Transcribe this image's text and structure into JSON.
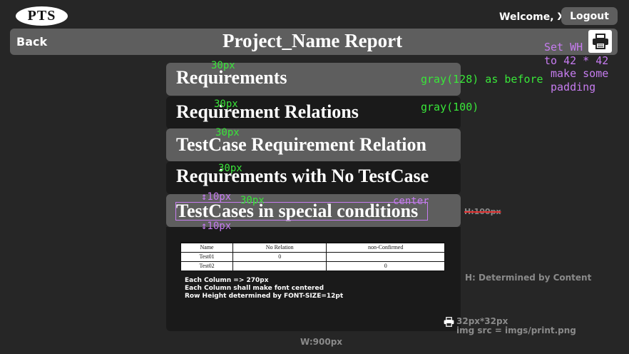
{
  "header": {
    "logo": "PTS",
    "welcome": "Welcome, XXX",
    "logout_label": "Logout"
  },
  "titlebar": {
    "back_label": "Back",
    "title": "Project_Name Report"
  },
  "menu": [
    {
      "label": "Requirements"
    },
    {
      "label": "Requirement Relations"
    },
    {
      "label": "TestCase Requirement Relation"
    },
    {
      "label": "Requirements with No TestCase"
    },
    {
      "label": "TestCases in special conditions"
    }
  ],
  "annotations": {
    "spacing": [
      "30px",
      "30px",
      "30px",
      "30px",
      "30px"
    ],
    "padding_top": "↕10px",
    "padding_bottom": "↕10px",
    "center": "center",
    "gray128": "gray(128) as before",
    "gray100": "gray(100)",
    "print_note_line1": "Set WH",
    "print_note_line2": "to 42 * 42",
    "print_note_line3": "make some",
    "print_note_line4": "padding",
    "height_strike": "H:100px",
    "height_content": "H: Determined by Content",
    "width": "W:900px",
    "small_icon_size": "32px*32px",
    "small_icon_src": "img src = imgs/print.png"
  },
  "table": {
    "headers": [
      "Name",
      "No Relation",
      "non-Confirmed"
    ],
    "rows": [
      [
        "Test01",
        "0",
        ""
      ],
      [
        "Test02",
        "",
        "0"
      ]
    ]
  },
  "notes": [
    "Each Column => 270px",
    "Each Column shall make font centered",
    "Row Height determined by FONT-SIZE=12pt"
  ],
  "colors": {
    "background": "#262626",
    "bar": "#5e5e5e",
    "dark_item": "#1a1a1a",
    "annotation_green": "#39e639",
    "annotation_purple": "#c67cf0"
  }
}
